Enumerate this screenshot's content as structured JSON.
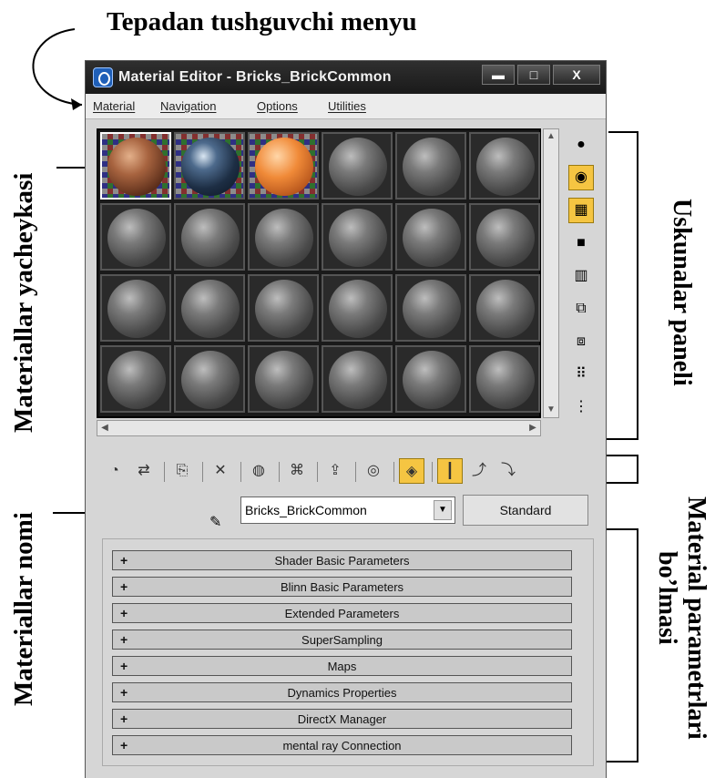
{
  "annotations": {
    "top_menu": "Tepadan tushguvchi menyu",
    "slots": "Materiallar yacheykasi",
    "toolbar": "Uskunalar paneli",
    "name": "Materiallar nomi",
    "params_line1": "Material parametrlari",
    "params_line2": "bo’lmasi"
  },
  "window": {
    "title": "Material Editor - Bricks_BrickCommon",
    "buttons": [
      "minimize",
      "maximize",
      "close"
    ]
  },
  "menu": [
    "Material",
    "Navigation",
    "Options",
    "Utilities"
  ],
  "slots": {
    "rows": 4,
    "cols": 6,
    "materials": [
      "brick",
      "glass",
      "orange"
    ],
    "selected_index": 0
  },
  "right_toolbar": {
    "icons": [
      "sample-sphere-icon",
      "backlight-icon",
      "checker-background-icon",
      "uv-tiling-icon",
      "video-color-check-icon",
      "make-preview-icon",
      "options-icon",
      "select-by-material-icon",
      "material-navigator-icon"
    ],
    "active": [
      1,
      2
    ]
  },
  "bottom_toolbar": {
    "icons": [
      "get-material-icon",
      "put-to-scene-icon",
      "assign-to-selection-icon",
      "reset-map-icon",
      "make-copy-icon",
      "make-unique-icon",
      "put-to-library-icon",
      "material-id-channel-icon",
      "show-map-in-viewport-icon",
      "show-end-result-icon",
      "go-to-parent-icon",
      "go-forward-sibling-icon"
    ],
    "active": [
      8,
      9
    ]
  },
  "name_row": {
    "material_name": "Bricks_BrickCommon",
    "type_button": "Standard"
  },
  "rollouts": [
    "Shader Basic Parameters",
    "Blinn Basic Parameters",
    "Extended Parameters",
    "SuperSampling",
    "Maps",
    "Dynamics Properties",
    "DirectX Manager",
    "mental ray Connection"
  ],
  "glyphs": {
    "plus": "+",
    "dropdown": "▼",
    "scroll_up": "▲",
    "scroll_down": "▼",
    "scroll_left": "◀",
    "scroll_right": "▶",
    "minimize": "▬",
    "maximize": "□",
    "close": "X",
    "pick": "✎"
  }
}
